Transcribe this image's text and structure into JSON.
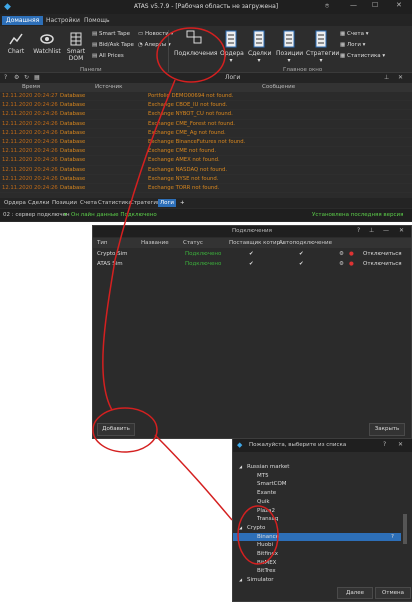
{
  "app": {
    "title": "ATAS v5.7.9 - [Рабочая область не загружена]"
  },
  "tabs": [
    {
      "label": "Домашняя"
    },
    {
      "label": "Настройки"
    },
    {
      "label": "Помощь"
    }
  ],
  "ribbon": {
    "chart": "Chart",
    "watchlist": "Watchlist",
    "smartdom": "Smart DOM",
    "smart_tape": "Smart Tape",
    "bidask_tape": "Bid/Ask Tape",
    "all_prices": "All Prices",
    "news": "Новости",
    "alerts": "Алерты",
    "panels_label": "Панели",
    "connections": "Подключения",
    "orders": "Ордера",
    "trades": "Сделки",
    "positions": "Позиции",
    "strategies": "Стратегии",
    "accounts": "Счета",
    "logs": "Логи",
    "statistics": "Статистика",
    "main_window_label": "Главное окно"
  },
  "logs": {
    "panel_title": "Логи",
    "headers": {
      "time": "Время",
      "source": "Источник",
      "message": "Сообщение"
    },
    "rows": [
      {
        "time": "12.11.2020 20:24:27",
        "source": "Database",
        "message": "Portfolio DEMO00694 not found."
      },
      {
        "time": "12.11.2020 20:24:26",
        "source": "Database",
        "message": "Exchange CBOE_IU not found."
      },
      {
        "time": "12.11.2020 20:24:26",
        "source": "Database",
        "message": "Exchange NYBOT_CU not found."
      },
      {
        "time": "12.11.2020 20:24:26",
        "source": "Database",
        "message": "Exchange CME_Forest not found."
      },
      {
        "time": "12.11.2020 20:24:26",
        "source": "Database",
        "message": "Exchange CME_Ag not found."
      },
      {
        "time": "12.11.2020 20:24:26",
        "source": "Database",
        "message": "Exchange BinanceFutures not found."
      },
      {
        "time": "12.11.2020 20:24:26",
        "source": "Database",
        "message": "Exchange CME not found."
      },
      {
        "time": "12.11.2020 20:24:26",
        "source": "Database",
        "message": "Exchange AMEX not found."
      },
      {
        "time": "12.11.2020 20:24:26",
        "source": "Database",
        "message": "Exchange NASDAQ not found."
      },
      {
        "time": "12.11.2020 20:24:26",
        "source": "Database",
        "message": "Exchange NYSE not found."
      },
      {
        "time": "12.11.2020 20:24:26",
        "source": "Database",
        "message": "Exchange TORR not found."
      }
    ]
  },
  "bottom_tabs": [
    {
      "label": "Ордера"
    },
    {
      "label": "Сделки"
    },
    {
      "label": "Позиции"
    },
    {
      "label": "Счета"
    },
    {
      "label": "Статистика"
    },
    {
      "label": "Стратегии"
    },
    {
      "label": "Логи"
    },
    {
      "label": "+"
    }
  ],
  "status": {
    "left": "02 : сервер подключен",
    "center": "Он лайн данные Подключено",
    "right": "Установлена последняя версия"
  },
  "connections": {
    "title": "Подключения",
    "headers": {
      "type": "Тип",
      "name": "Название",
      "status": "Статус",
      "supplier": "Поставщик котир...",
      "autoconnect": "Автоподключение"
    },
    "rows": [
      {
        "type": "Crypto Sim",
        "status": "Подключено",
        "action": "Отключиться"
      },
      {
        "type": "ATAS Sim",
        "status": "Подключено",
        "action": "Отключиться"
      }
    ],
    "add_button": "Добавить",
    "close_button": "Закрыть"
  },
  "picker": {
    "title": "Пожалуйста, выберите из списка",
    "items": [
      {
        "label": "Russian market",
        "level": 0
      },
      {
        "label": "MT5",
        "level": 1
      },
      {
        "label": "SmartCOM",
        "level": 1
      },
      {
        "label": "Exante",
        "level": 1
      },
      {
        "label": "Quik",
        "level": 1
      },
      {
        "label": "Plaza2",
        "level": 1
      },
      {
        "label": "Transaq",
        "level": 1
      },
      {
        "label": "Crypto",
        "level": 0
      },
      {
        "label": "Binance",
        "level": 1
      },
      {
        "label": "Huobi",
        "level": 1
      },
      {
        "label": "Bitfinex",
        "level": 1
      },
      {
        "label": "BitMEX",
        "level": 1
      },
      {
        "label": "BitTrex",
        "level": 1
      },
      {
        "label": "Simulator",
        "level": 0
      }
    ],
    "next_button": "Далее",
    "cancel_button": "Отмена"
  },
  "colors": {
    "accent": "#2d6fb8",
    "log_text": "#d9871e",
    "annotation": "#d42020"
  }
}
